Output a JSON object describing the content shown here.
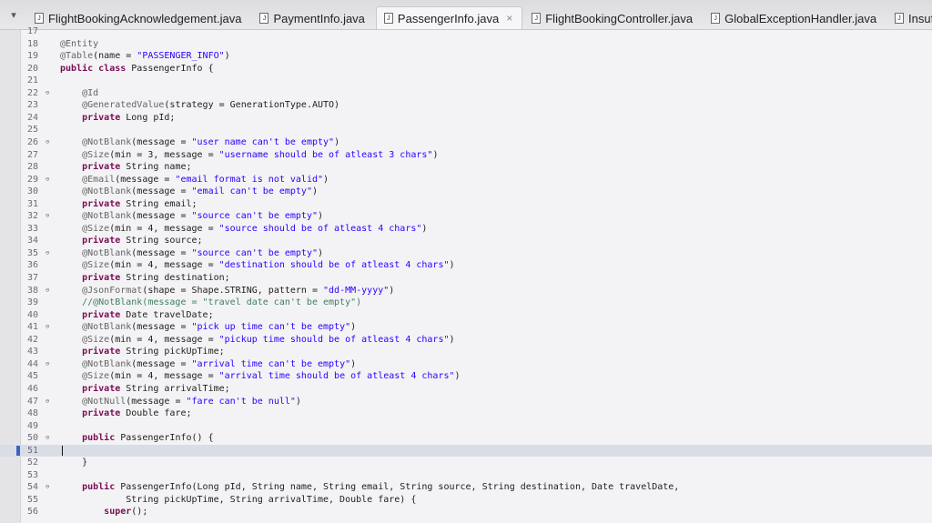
{
  "tabs": [
    {
      "label": "FlightBookingAcknowledgement.java",
      "active": false
    },
    {
      "label": "PaymentInfo.java",
      "active": false
    },
    {
      "label": "PassengerInfo.java",
      "active": true,
      "close": "×"
    },
    {
      "label": "FlightBookingController.java",
      "active": false
    },
    {
      "label": "GlobalExceptionHandler.java",
      "active": false
    },
    {
      "label": "InsufficientA",
      "active": false
    }
  ],
  "lines": [
    {
      "n": "17",
      "t": ""
    },
    {
      "n": "18",
      "t": "@Entity"
    },
    {
      "n": "19",
      "t": "@Table(name = \"PASSENGER_INFO\")"
    },
    {
      "n": "20",
      "t": "public class PassengerInfo {"
    },
    {
      "n": "21",
      "t": ""
    },
    {
      "n": "22",
      "t": "    @Id",
      "fold": true
    },
    {
      "n": "23",
      "t": "    @GeneratedValue(strategy = GenerationType.AUTO)"
    },
    {
      "n": "24",
      "t": "    private Long pId;"
    },
    {
      "n": "25",
      "t": ""
    },
    {
      "n": "26",
      "t": "    @NotBlank(message = \"user name can't be empty\")",
      "fold": true
    },
    {
      "n": "27",
      "t": "    @Size(min = 3, message = \"username should be of atleast 3 chars\")"
    },
    {
      "n": "28",
      "t": "    private String name;"
    },
    {
      "n": "29",
      "t": "    @Email(message = \"email format is not valid\")",
      "fold": true
    },
    {
      "n": "30",
      "t": "    @NotBlank(message = \"email can't be empty\")"
    },
    {
      "n": "31",
      "t": "    private String email;"
    },
    {
      "n": "32",
      "t": "    @NotBlank(message = \"source can't be empty\")",
      "fold": true
    },
    {
      "n": "33",
      "t": "    @Size(min = 4, message = \"source should be of atleast 4 chars\")"
    },
    {
      "n": "34",
      "t": "    private String source;"
    },
    {
      "n": "35",
      "t": "    @NotBlank(message = \"source can't be empty\")",
      "fold": true
    },
    {
      "n": "36",
      "t": "    @Size(min = 4, message = \"destination should be of atleast 4 chars\")"
    },
    {
      "n": "37",
      "t": "    private String destination;"
    },
    {
      "n": "38",
      "t": "    @JsonFormat(shape = Shape.STRING, pattern = \"dd-MM-yyyy\")",
      "fold": true
    },
    {
      "n": "39",
      "t": "    //@NotBlank(message = \"travel date can't be empty\")"
    },
    {
      "n": "40",
      "t": "    private Date travelDate;"
    },
    {
      "n": "41",
      "t": "    @NotBlank(message = \"pick up time can't be empty\")",
      "fold": true
    },
    {
      "n": "42",
      "t": "    @Size(min = 4, message = \"pickup time should be of atleast 4 chars\")"
    },
    {
      "n": "43",
      "t": "    private String pickUpTime;"
    },
    {
      "n": "44",
      "t": "    @NotBlank(message = \"arrival time can't be empty\")",
      "fold": true
    },
    {
      "n": "45",
      "t": "    @Size(min = 4, message = \"arrival time should be of atleast 4 chars\")"
    },
    {
      "n": "46",
      "t": "    private String arrivalTime;"
    },
    {
      "n": "47",
      "t": "    @NotNull(message = \"fare can't be null\")",
      "fold": true
    },
    {
      "n": "48",
      "t": "    private Double fare;"
    },
    {
      "n": "49",
      "t": ""
    },
    {
      "n": "50",
      "t": "    public PassengerInfo() {",
      "fold": true
    },
    {
      "n": "51",
      "t": "",
      "current": true
    },
    {
      "n": "52",
      "t": "    }"
    },
    {
      "n": "53",
      "t": ""
    },
    {
      "n": "54",
      "t": "    public PassengerInfo(Long pId, String name, String email, String source, String destination, Date travelDate,",
      "fold": true
    },
    {
      "n": "55",
      "t": "            String pickUpTime, String arrivalTime, Double fare) {"
    },
    {
      "n": "56",
      "t": "        super();"
    }
  ],
  "colors": {
    "keyword": "#7a0d55",
    "string": "#2a00ff",
    "annotation": "#646464",
    "comment": "#3f7f5f"
  }
}
